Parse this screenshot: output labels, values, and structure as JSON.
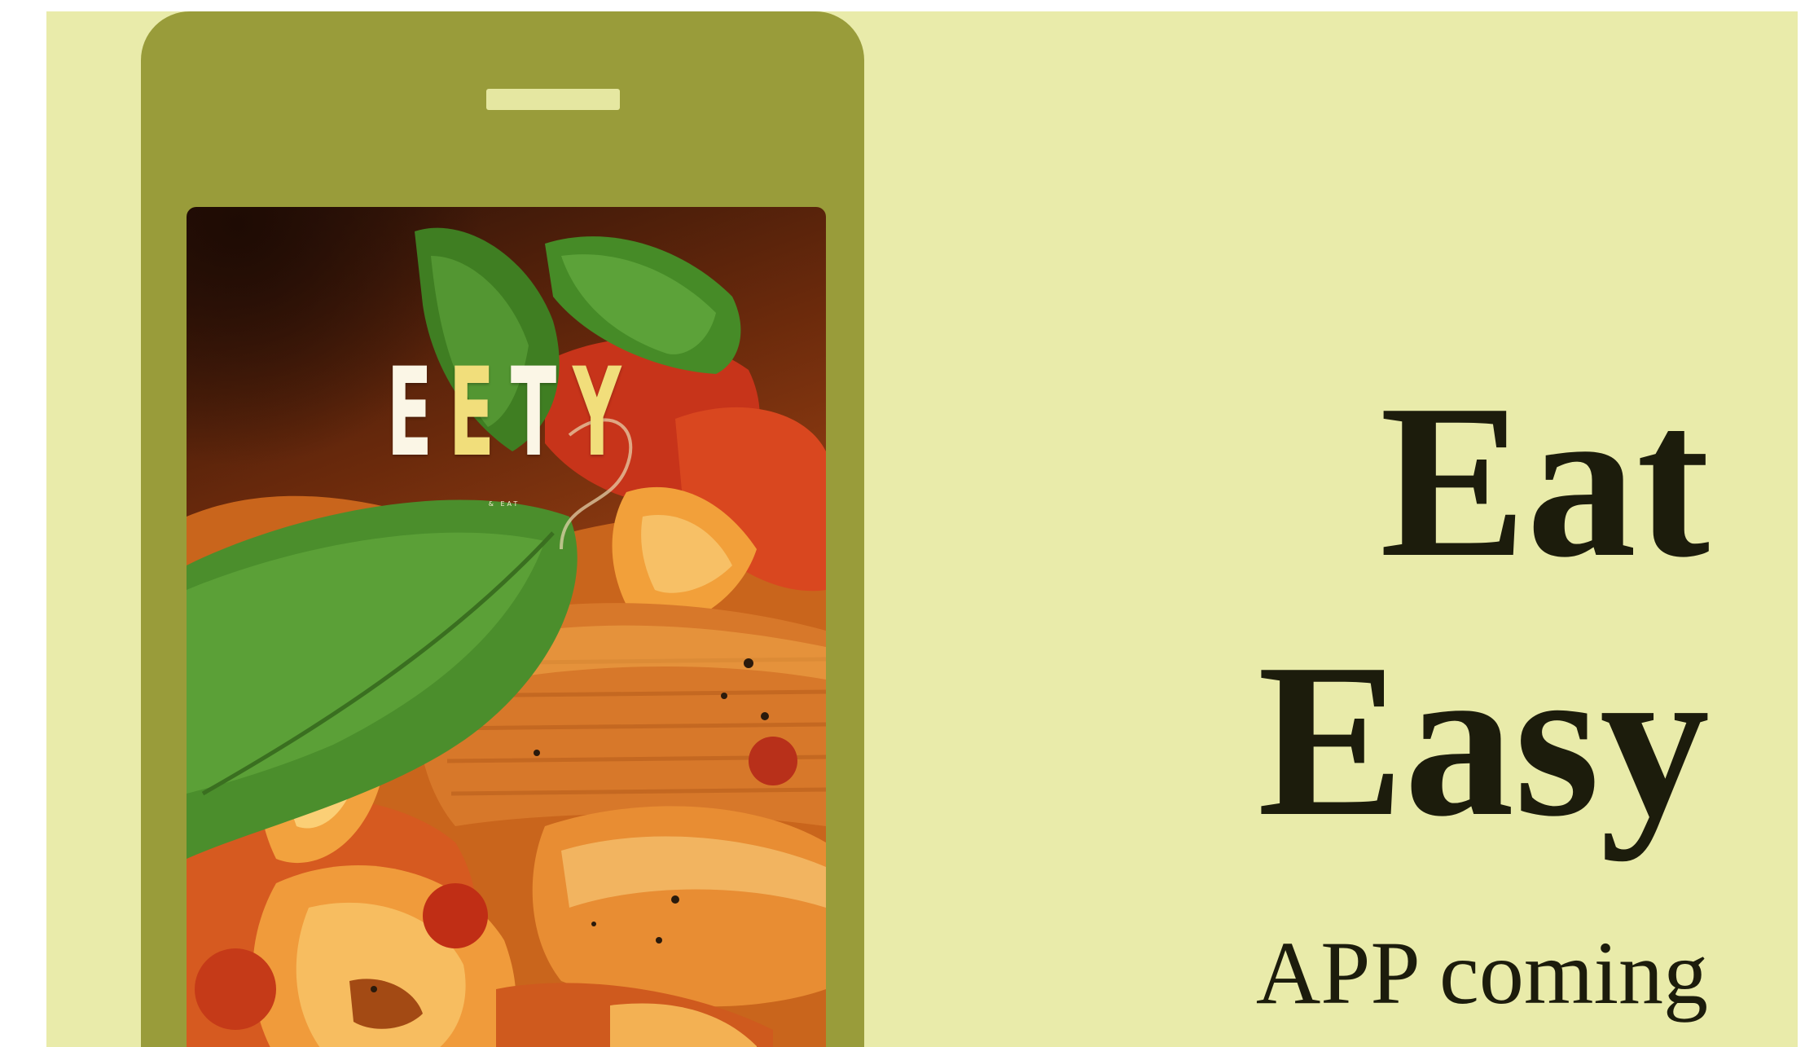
{
  "phone": {
    "app_logo": {
      "letters": [
        "E",
        "E",
        "T",
        "Y"
      ],
      "subtext": "& EAT"
    }
  },
  "hero": {
    "title_line1": "Eat",
    "title_line2": "Easy",
    "tagline": "APP coming"
  },
  "colors": {
    "background": "#e9ebaa",
    "phone_body": "#999c3a",
    "speaker": "#e5e7a1",
    "text_dark": "#1c1c0c",
    "logo_light": "#fbf6e6",
    "logo_yellow": "#f1de7b"
  },
  "images": {
    "phone_screen": "pasta-penne-with-tomato-sauce-and-basil"
  }
}
